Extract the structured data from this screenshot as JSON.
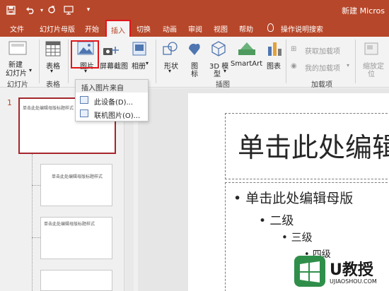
{
  "titlebar": {
    "title": "新建 Micros",
    "icons": [
      "save-icon",
      "undo-icon",
      "redo-icon",
      "slideshow-icon",
      "customize-icon"
    ]
  },
  "tabs": [
    {
      "label": "文件"
    },
    {
      "label": "幻灯片母版"
    },
    {
      "label": "开始"
    },
    {
      "label": "插入",
      "active": true
    },
    {
      "label": "切换"
    },
    {
      "label": "动画"
    },
    {
      "label": "审阅"
    },
    {
      "label": "视图"
    },
    {
      "label": "帮助"
    },
    {
      "label": "操作说明搜索"
    }
  ],
  "ribbon": {
    "new_slide_line1": "新建",
    "new_slide_line2": "幻灯片",
    "table": "表格",
    "picture": "图片",
    "screenshot": "屏幕截图",
    "album": "相册",
    "shapes": "形状",
    "icons": "图",
    "icons2": "标",
    "model3d_line1": "3D 模",
    "model3d_line2": "型",
    "smartart": "SmartArt",
    "chart": "图表",
    "get_addins": "获取加载项",
    "my_addins": "我的加载项",
    "zoom_line1": "缩放定",
    "zoom_line2": "位",
    "groups": {
      "slides": "幻灯片",
      "tables": "表格",
      "illustrations": "插图",
      "addins": "加载项"
    }
  },
  "menu": {
    "header": "插入图片来自",
    "items": [
      {
        "label": "此设备(D)..."
      },
      {
        "label": "联机图片(O)..."
      }
    ]
  },
  "thumbnails": {
    "selected_number": "1",
    "thumb1_title": "单击此处编辑母版标题样式",
    "thumb2_title": "单击此处编辑母版标题样式",
    "thumb3_title": "单击此处编辑母版标题样式"
  },
  "slide": {
    "title": "单击此处编辑",
    "bullets": [
      {
        "text": "• 单击此处编辑母版",
        "level": 1
      },
      {
        "text": "• 二级",
        "level": 2
      },
      {
        "text": "• 三级",
        "level": 3
      },
      {
        "text": "• 四级",
        "level": 4
      }
    ]
  },
  "watermark": {
    "brand": "U教授",
    "url": "UJIAOSHOU.COM"
  },
  "colors": {
    "accent": "#b7472a",
    "highlight": "#e0161b"
  }
}
